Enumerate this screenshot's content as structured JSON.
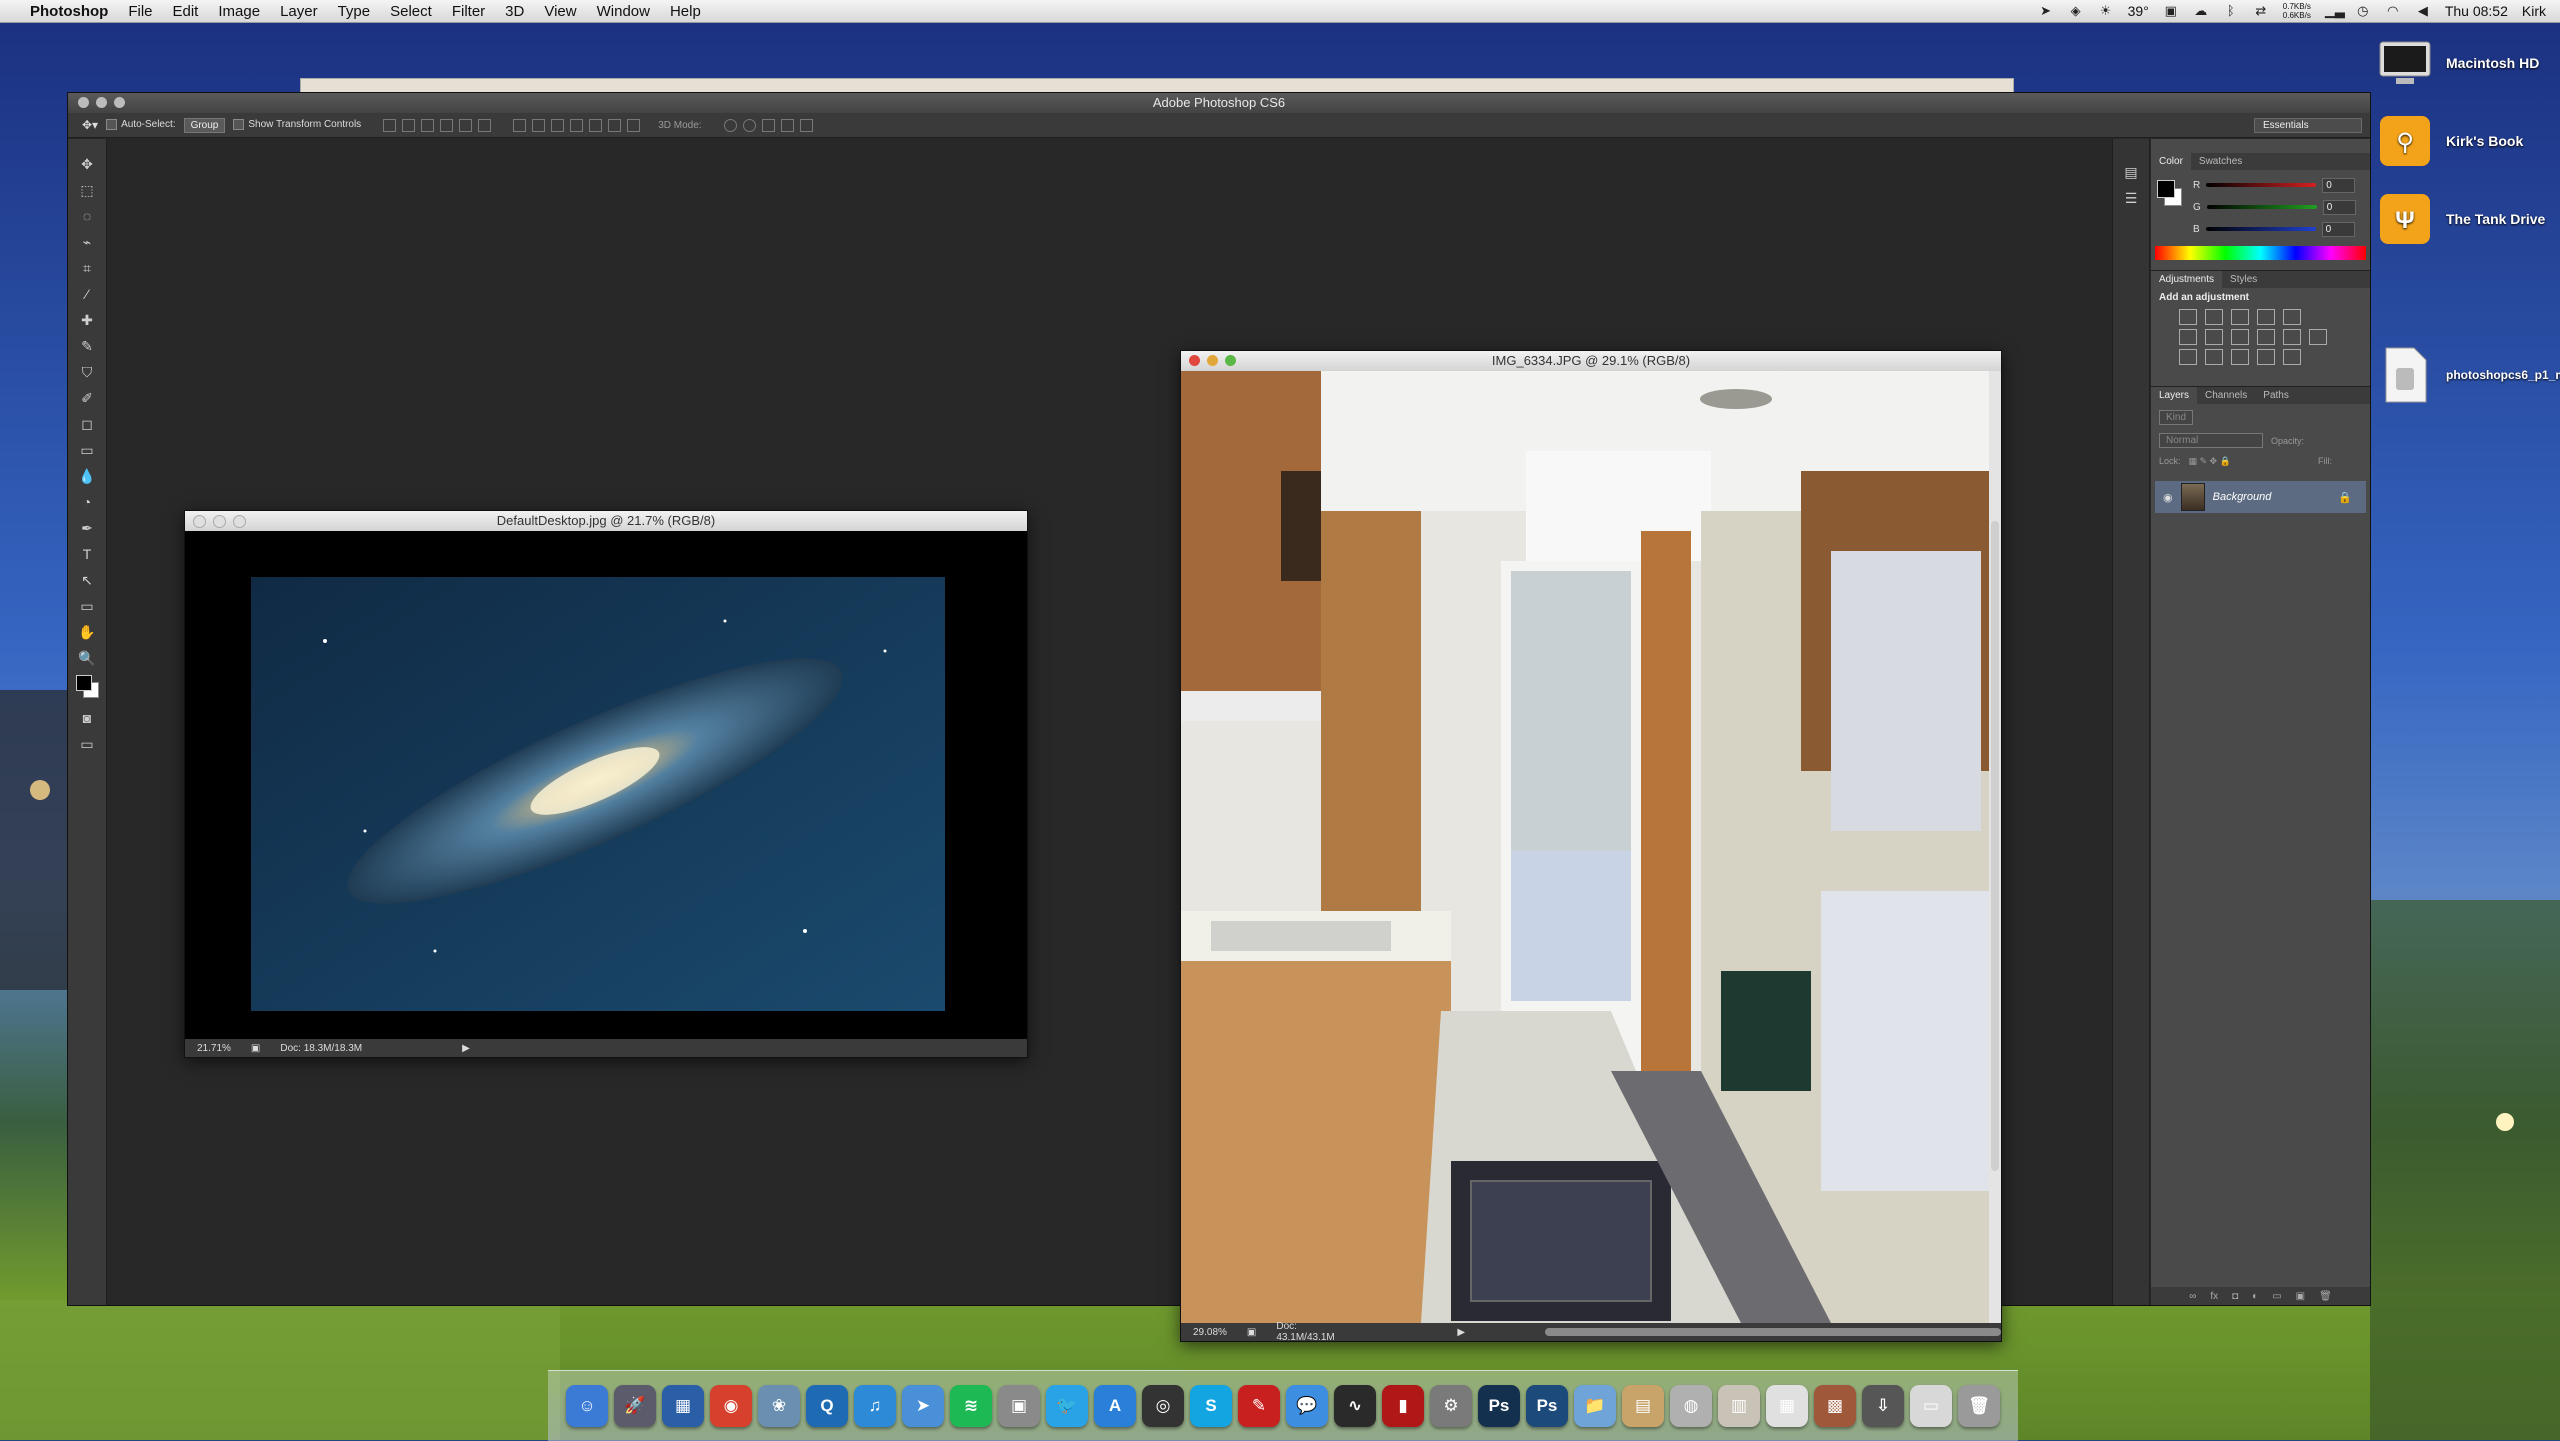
{
  "menubar": {
    "apple": "",
    "app_name": "Photoshop",
    "menus": [
      "File",
      "Edit",
      "Image",
      "Layer",
      "Type",
      "Select",
      "Filter",
      "3D",
      "View",
      "Window",
      "Help"
    ],
    "temperature": "39°",
    "net_up": "0.7KB/s",
    "net_down": "0.6KB/s",
    "clock": "Thu 08:52",
    "user": "Kirk"
  },
  "desktop_icons": [
    {
      "label": "Macintosh HD",
      "icon": "hard-drive-icon"
    },
    {
      "label": "Kirk's Book",
      "icon": "usb-drive-icon"
    },
    {
      "label": "The Tank Drive",
      "icon": "usb-drive-icon"
    },
    {
      "label": "photoshopcs6_p1_ma...2.dmg",
      "icon": "dmg-file-icon"
    }
  ],
  "photoshop": {
    "window_title": "Adobe Photoshop CS6",
    "options": {
      "auto_select_label": "Auto-Select:",
      "auto_select_value": "Group",
      "transform_label": "Show Transform Controls",
      "mode_label": "3D Mode:",
      "workspace": "Essentials"
    },
    "tools": [
      "move-tool-icon",
      "marquee-tool-icon",
      "lasso-tool-icon",
      "quick-select-tool-icon",
      "crop-tool-icon",
      "eyedropper-tool-icon",
      "healing-brush-icon",
      "brush-tool-icon",
      "clone-stamp-icon",
      "history-brush-icon",
      "eraser-tool-icon",
      "gradient-tool-icon",
      "blur-tool-icon",
      "dodge-tool-icon",
      "pen-tool-icon",
      "type-tool-icon",
      "path-select-icon",
      "shape-tool-icon",
      "hand-tool-icon",
      "zoom-tool-icon"
    ],
    "tool_glyphs": [
      "✥",
      "⬚",
      "◌",
      "⌁",
      "⌗",
      "⁄",
      "✚",
      "✎",
      "⛉",
      "✐",
      "◻",
      "▭",
      "💧",
      "◔",
      "✒",
      "T",
      "↖",
      "▭",
      "✋",
      "🔍"
    ],
    "color_panel": {
      "tabs": [
        "Color",
        "Swatches"
      ],
      "channels": [
        {
          "label": "R",
          "value": "0",
          "color": "#d42020"
        },
        {
          "label": "G",
          "value": "0",
          "color": "#20a020"
        },
        {
          "label": "B",
          "value": "0",
          "color": "#2040d0"
        }
      ]
    },
    "adjustments_panel": {
      "tabs": [
        "Adjustments",
        "Styles"
      ],
      "heading": "Add an adjustment"
    },
    "layers_panel": {
      "tabs": [
        "Layers",
        "Channels",
        "Paths"
      ],
      "kind_filter": "Kind",
      "blend_mode": "Normal",
      "opacity_label": "Opacity:",
      "lock_label": "Lock:",
      "fill_label": "Fill:",
      "layers": [
        {
          "name": "Background",
          "locked": true,
          "visible": true
        }
      ]
    }
  },
  "documents": [
    {
      "title": "DefaultDesktop.jpg @ 21.7% (RGB/8)",
      "zoom": "21.71%",
      "doc_size": "Doc: 18.3M/18.3M"
    },
    {
      "title": "IMG_6334.JPG @ 29.1% (RGB/8)",
      "zoom": "29.08%",
      "doc_size": "Doc: 43.1M/43.1M"
    }
  ],
  "dock": [
    {
      "name": "finder-icon",
      "glyph": "☺",
      "color": "#3b7bd6"
    },
    {
      "name": "launchpad-icon",
      "glyph": "🚀",
      "color": "#5b5b6b"
    },
    {
      "name": "mission-control-icon",
      "glyph": "▦",
      "color": "#2a5fa8"
    },
    {
      "name": "chrome-icon",
      "glyph": "◉",
      "color": "#d8402e"
    },
    {
      "name": "iphoto-icon",
      "glyph": "❀",
      "color": "#6a8fb0"
    },
    {
      "name": "quicktime-icon",
      "glyph": "Q",
      "color": "#1e6ab3"
    },
    {
      "name": "itunes-icon",
      "glyph": "♫",
      "color": "#2c8ad6"
    },
    {
      "name": "paper-plane-icon",
      "glyph": "➤",
      "color": "#4a90d9"
    },
    {
      "name": "spotify-icon",
      "glyph": "≋",
      "color": "#1db954"
    },
    {
      "name": "screenshot-icon",
      "glyph": "▣",
      "color": "#8a8a8a"
    },
    {
      "name": "twitter-icon",
      "glyph": "🐦",
      "color": "#2aa3e6"
    },
    {
      "name": "app-store-icon",
      "glyph": "A",
      "color": "#2a7fd8"
    },
    {
      "name": "aperture-icon",
      "glyph": "◎",
      "color": "#333333"
    },
    {
      "name": "skype-icon",
      "glyph": "S",
      "color": "#12a5e2"
    },
    {
      "name": "pdf-reader-icon",
      "glyph": "✎",
      "color": "#c8201e"
    },
    {
      "name": "messages-icon",
      "glyph": "💬",
      "color": "#3d8de0"
    },
    {
      "name": "activity-monitor-icon",
      "glyph": "∿",
      "color": "#2a2a2a"
    },
    {
      "name": "photo-booth-icon",
      "glyph": "▮",
      "color": "#b01818"
    },
    {
      "name": "system-preferences-icon",
      "glyph": "⚙",
      "color": "#7a7a7a"
    },
    {
      "name": "photoshop-icon-1",
      "glyph": "Ps",
      "color": "#14304f"
    },
    {
      "name": "photoshop-icon-2",
      "glyph": "Ps",
      "color": "#1c4a7a"
    },
    {
      "name": "folder-icon",
      "glyph": "📁",
      "color": "#6ea4d8"
    },
    {
      "name": "documents-folder-icon",
      "glyph": "▤",
      "color": "#c8a46a"
    },
    {
      "name": "disk-utility-icon",
      "glyph": "◍",
      "color": "#b0b0b0"
    },
    {
      "name": "archive-icon",
      "glyph": "▥",
      "color": "#c9c2b6"
    },
    {
      "name": "calendar-grid-icon",
      "glyph": "▦",
      "color": "#e0e0e0"
    },
    {
      "name": "media-stack-icon",
      "glyph": "▩",
      "color": "#a0583a"
    },
    {
      "name": "downloads-stack-icon",
      "glyph": "⇩",
      "color": "#565656"
    },
    {
      "name": "document-stack-icon",
      "glyph": "▭",
      "color": "#d8d8d8"
    },
    {
      "name": "trash-icon",
      "glyph": "🗑",
      "color": "#9a9a9a"
    }
  ]
}
